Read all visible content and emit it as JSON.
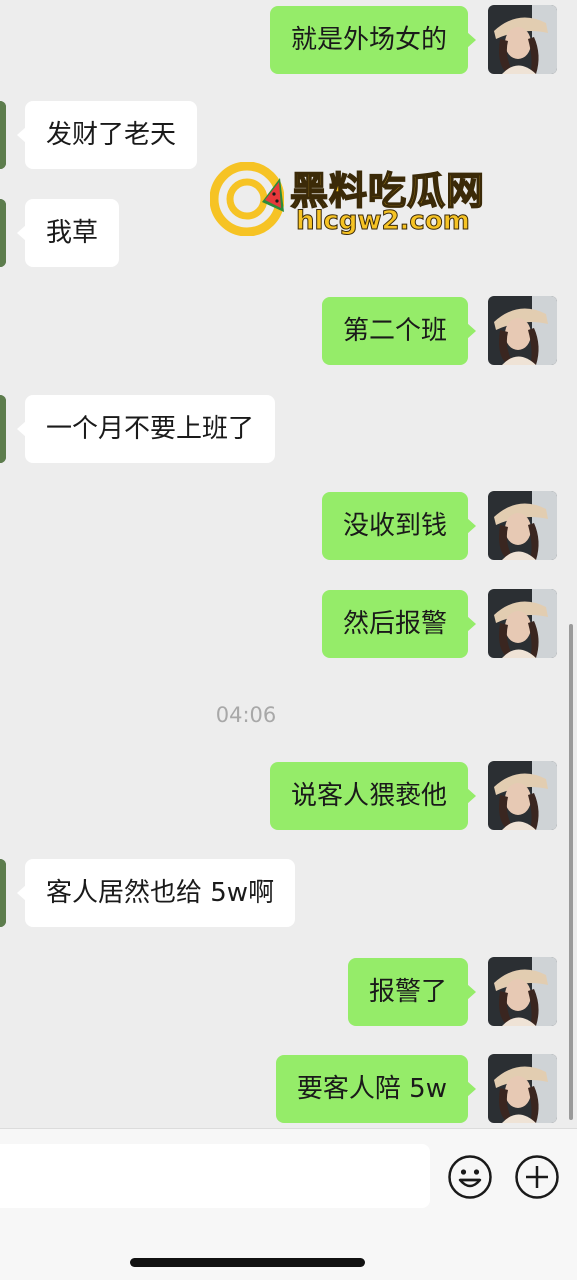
{
  "messages": [
    {
      "side": "out",
      "text": "就是外场女的"
    },
    {
      "side": "in",
      "text": "发财了老天"
    },
    {
      "side": "in",
      "text": "我草"
    },
    {
      "side": "out",
      "text": "第二个班"
    },
    {
      "side": "in",
      "text": "一个月不要上班了"
    },
    {
      "side": "out",
      "text": "没收到钱"
    },
    {
      "side": "out",
      "text": "然后报警"
    },
    {
      "timestamp": "04:06"
    },
    {
      "side": "out",
      "text": "说客人猥亵他"
    },
    {
      "side": "in",
      "text": "客人居然也给 5w啊"
    },
    {
      "side": "out",
      "text": "报警了"
    },
    {
      "side": "out",
      "text": "要客人陪 5w"
    }
  ],
  "watermark": {
    "title": "黑料吃瓜网",
    "url": "hlcgw2.com"
  },
  "composer": {
    "input_value": "",
    "icons": [
      "emoji-icon",
      "plus-icon"
    ]
  },
  "colors": {
    "background": "#ededed",
    "outgoing_bubble": "#95ec69",
    "incoming_bubble": "#ffffff",
    "watermark_gold": "#f6c324"
  }
}
